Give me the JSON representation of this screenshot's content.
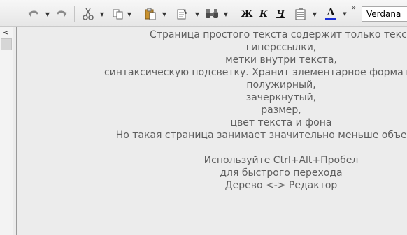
{
  "toolbar": {
    "icons": [
      "undo-icon",
      "redo-icon",
      "cut-icon",
      "copy-icon",
      "paste-icon",
      "paste-special-icon",
      "find-icon"
    ],
    "format": {
      "bold": "Ж",
      "italic": "К",
      "underline": "Ч",
      "font_color_glyph": "A"
    },
    "overflow_glyph": "»",
    "font_name": "Verdana"
  },
  "tree": {
    "scroll_up_glyph": "<"
  },
  "editor": {
    "lines": [
      "Страница простого текста содержит только текст",
      "гиперссылки,",
      "метки внутри текста,",
      "синтаксическую подсветку. Хранит элементарное форматирование",
      "полужирный,",
      "зачеркнутый,",
      "размер,",
      "цвет текста и фона",
      "Но такая страница занимает значительно меньше объема в фа",
      "",
      "Используйте Ctrl+Alt+Пробел",
      "для быстрого перехода",
      "Дерево <-> Редактор"
    ]
  },
  "colors": {
    "text": "#5e5e5e",
    "background": "#ececec",
    "font_color_underline": "#1a2fd6"
  }
}
